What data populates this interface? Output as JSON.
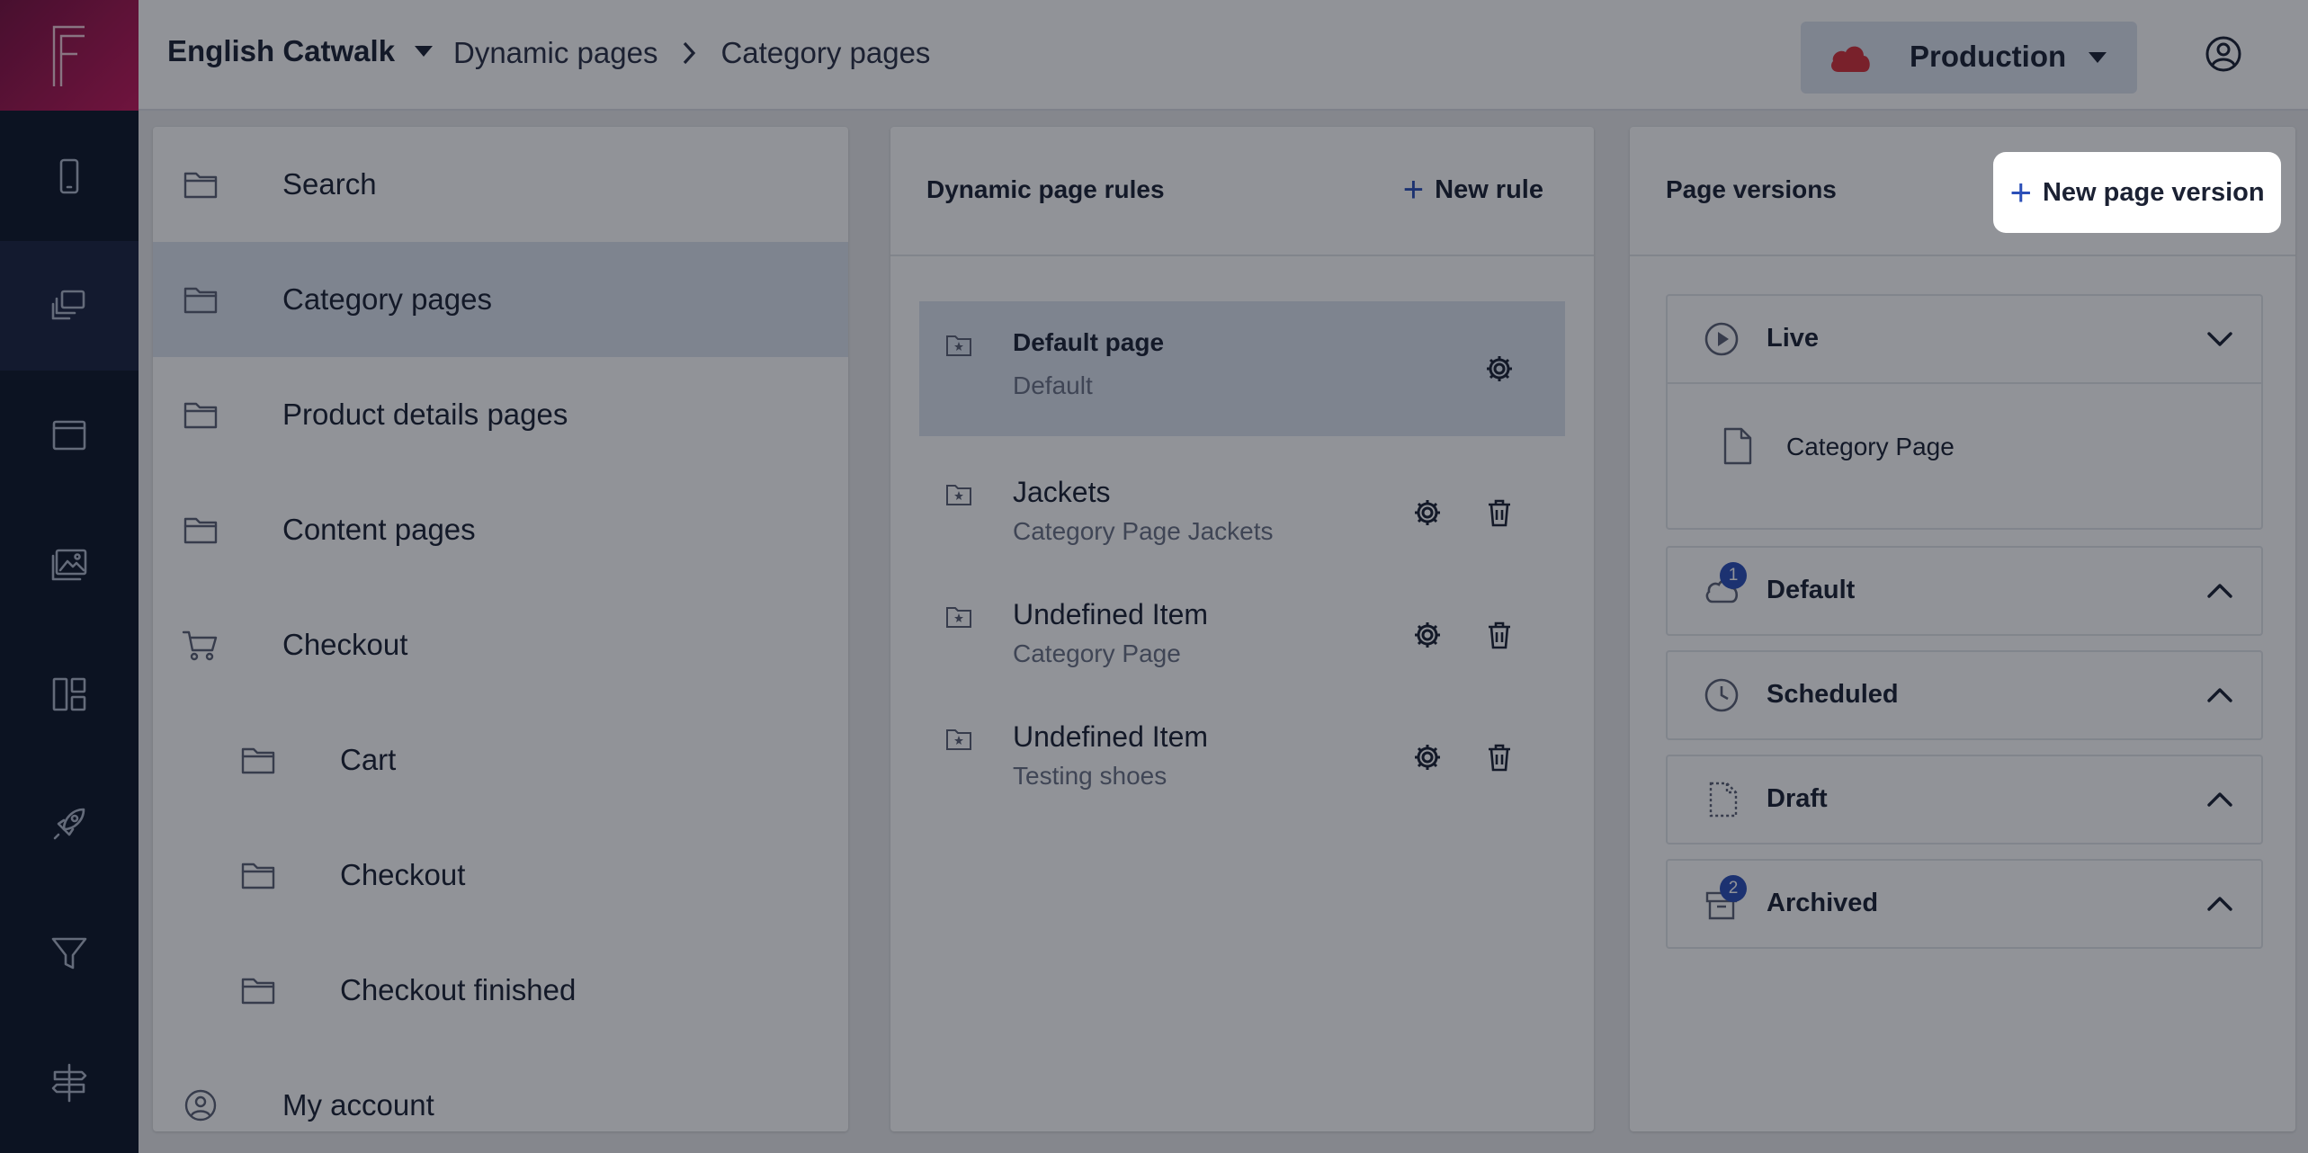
{
  "topbar": {
    "site_name": "English Catwalk",
    "breadcrumb": [
      "Dynamic pages",
      "Category pages"
    ],
    "environment": "Production"
  },
  "rail": {
    "items": [
      "mobile-icon",
      "pages-icon",
      "window-icon",
      "media-icon",
      "layout-icon",
      "rocket-icon",
      "filter-icon",
      "signpost-icon"
    ],
    "active_index": 1
  },
  "sidebar": {
    "items": [
      {
        "label": "Search",
        "icon": "folder-icon",
        "indent": 0
      },
      {
        "label": "Category pages",
        "icon": "folder-icon",
        "indent": 0,
        "selected": true
      },
      {
        "label": "Product details pages",
        "icon": "folder-icon",
        "indent": 0
      },
      {
        "label": "Content pages",
        "icon": "folder-icon",
        "indent": 0
      },
      {
        "label": "Checkout",
        "icon": "cart-icon",
        "indent": 0
      },
      {
        "label": "Cart",
        "icon": "folder-icon",
        "indent": 1
      },
      {
        "label": "Checkout",
        "icon": "folder-icon",
        "indent": 1
      },
      {
        "label": "Checkout finished",
        "icon": "folder-icon",
        "indent": 1
      },
      {
        "label": "My account",
        "icon": "user-circle-icon",
        "indent": 0
      }
    ]
  },
  "rules_panel": {
    "title": "Dynamic page rules",
    "new_label": "New rule",
    "rules": [
      {
        "name": "Default page",
        "sub": "Default",
        "selected": true,
        "deletable": false
      },
      {
        "name": "Jackets",
        "sub": "Category Page Jackets",
        "deletable": true
      },
      {
        "name": "Undefined Item",
        "sub": "Category Page",
        "deletable": true
      },
      {
        "name": "Undefined Item",
        "sub": "Testing shoes",
        "deletable": true
      }
    ]
  },
  "versions_panel": {
    "title": "Page versions",
    "new_label": "New page version",
    "sections": [
      {
        "label": "Live",
        "icon": "play-circle-icon",
        "expanded": true,
        "items": [
          "Category Page"
        ]
      },
      {
        "label": "Default",
        "icon": "cloud-icon",
        "badge": "1",
        "expanded": false
      },
      {
        "label": "Scheduled",
        "icon": "clock-icon",
        "expanded": false
      },
      {
        "label": "Draft",
        "icon": "draft-file-icon",
        "expanded": false
      },
      {
        "label": "Archived",
        "icon": "archive-icon",
        "badge": "2",
        "expanded": false
      }
    ]
  },
  "colors": {
    "rail_bg": "#0e1628",
    "accent": "#2b4fb8",
    "logo_gradient": [
      "#7a1040",
      "#c2185b"
    ],
    "production_cloud": "#d3303a"
  }
}
